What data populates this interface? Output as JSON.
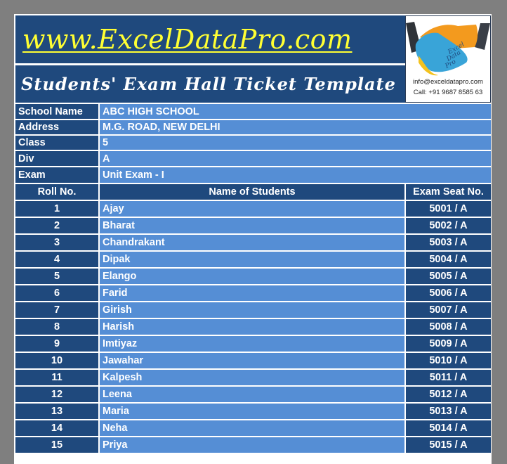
{
  "header": {
    "site": "www.ExcelDataPro.com",
    "title": "Students' Exam Hall Ticket Template",
    "logo_text": [
      "Excel",
      "Data",
      "Pro"
    ],
    "email": "info@exceldatapro.com",
    "phone": "Call: +91 9687 8585 63"
  },
  "info": [
    {
      "label": "School Name",
      "value": "ABC HIGH SCHOOL",
      "comment": false
    },
    {
      "label": "Address",
      "value": "M.G. ROAD, NEW DELHI",
      "comment": false
    },
    {
      "label": "Class",
      "value": "5",
      "comment": true
    },
    {
      "label": "Div",
      "value": "A",
      "comment": true
    },
    {
      "label": "Exam",
      "value": "Unit Exam - I",
      "comment": false
    }
  ],
  "table": {
    "columns": [
      "Roll No.",
      "Name of Students",
      "Exam Seat No."
    ],
    "rows": [
      {
        "roll": "1",
        "name": "Ajay",
        "seat": "5001 / A"
      },
      {
        "roll": "2",
        "name": "Bharat",
        "seat": "5002 / A"
      },
      {
        "roll": "3",
        "name": "Chandrakant",
        "seat": "5003 / A"
      },
      {
        "roll": "4",
        "name": "Dipak",
        "seat": "5004 / A"
      },
      {
        "roll": "5",
        "name": "Elango",
        "seat": "5005 / A"
      },
      {
        "roll": "6",
        "name": "Farid",
        "seat": "5006 / A"
      },
      {
        "roll": "7",
        "name": "Girish",
        "seat": "5007 / A"
      },
      {
        "roll": "8",
        "name": "Harish",
        "seat": "5008 / A"
      },
      {
        "roll": "9",
        "name": "Imtiyaz",
        "seat": "5009 / A"
      },
      {
        "roll": "10",
        "name": "Jawahar",
        "seat": "5010 / A"
      },
      {
        "roll": "11",
        "name": "Kalpesh",
        "seat": "5011 / A"
      },
      {
        "roll": "12",
        "name": "Leena",
        "seat": "5012 / A"
      },
      {
        "roll": "13",
        "name": "Maria",
        "seat": "5013 / A"
      },
      {
        "roll": "14",
        "name": "Neha",
        "seat": "5014 / A"
      },
      {
        "roll": "15",
        "name": "Priya",
        "seat": "5015 / A"
      }
    ]
  },
  "colors": {
    "dark_blue": "#1f497d",
    "light_blue": "#558ed5",
    "site_yellow": "#ffff33",
    "comment_red": "#c0143c"
  }
}
